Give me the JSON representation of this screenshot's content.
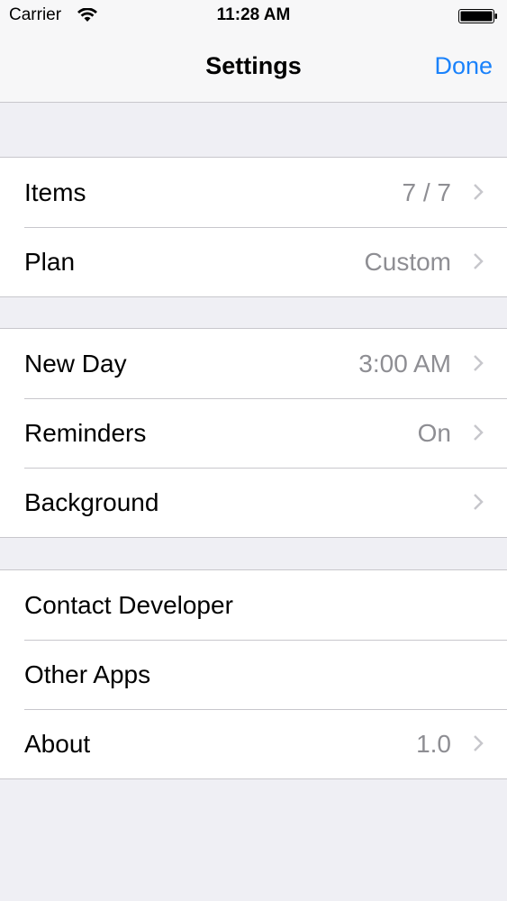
{
  "status_bar": {
    "carrier": "Carrier",
    "time": "11:28 AM",
    "wifi_icon": "wifi-icon",
    "battery_icon": "battery-icon"
  },
  "navbar": {
    "title": "Settings",
    "done_label": "Done"
  },
  "colors": {
    "accent": "#1a82fb",
    "background": "#efeff4",
    "value_text": "#8e8e93",
    "separator": "#c8c7cc"
  },
  "groups": [
    {
      "rows": [
        {
          "label": "Items",
          "value": "7 / 7",
          "chevron": true
        },
        {
          "label": "Plan",
          "value": "Custom",
          "chevron": true
        }
      ]
    },
    {
      "rows": [
        {
          "label": "New Day",
          "value": "3:00 AM",
          "chevron": true
        },
        {
          "label": "Reminders",
          "value": "On",
          "chevron": true
        },
        {
          "label": "Background",
          "value": "",
          "chevron": true
        }
      ]
    },
    {
      "rows": [
        {
          "label": "Contact Developer",
          "value": "",
          "chevron": false
        },
        {
          "label": "Other Apps",
          "value": "",
          "chevron": false
        },
        {
          "label": "About",
          "value": "1.0",
          "chevron": true
        }
      ]
    }
  ]
}
